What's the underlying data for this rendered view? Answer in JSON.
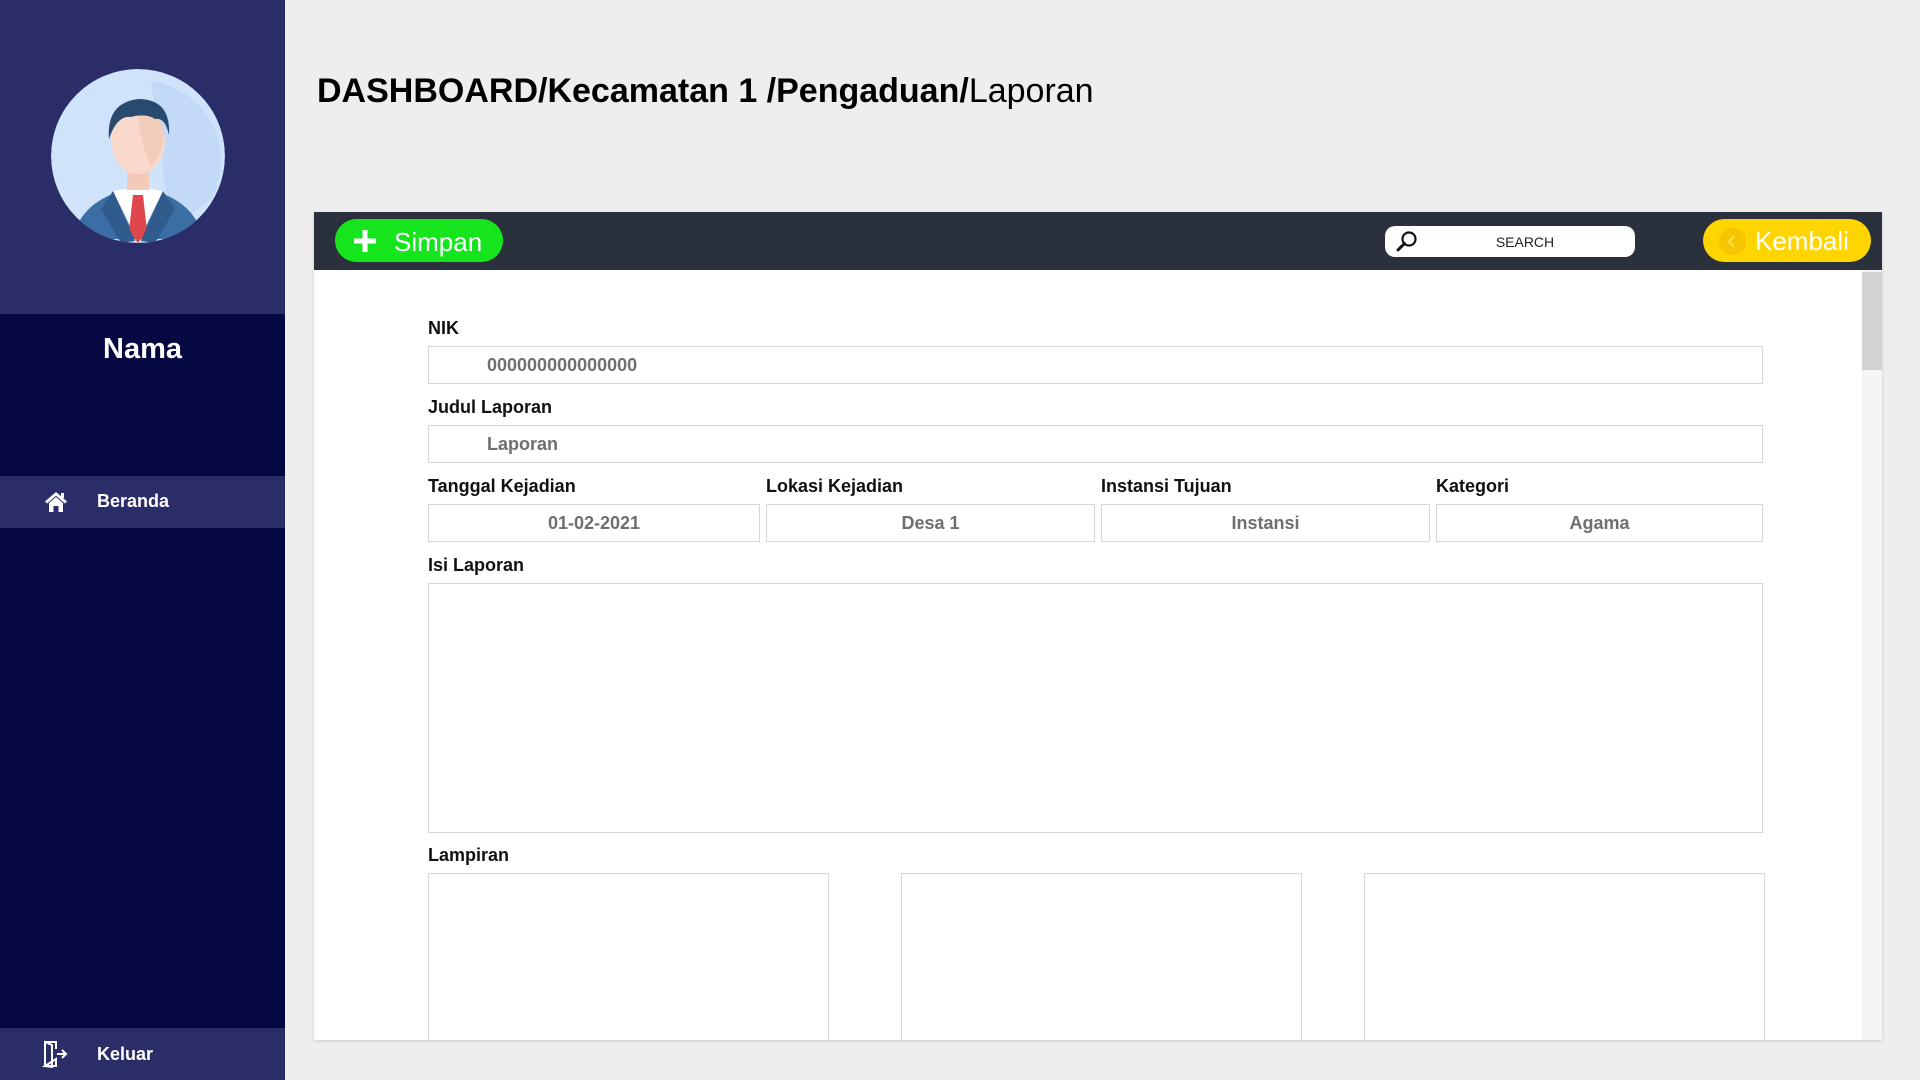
{
  "sidebar": {
    "user_name": "Nama",
    "nav": [
      {
        "label": "Beranda",
        "icon": "home-icon"
      }
    ],
    "logout_label": "Keluar"
  },
  "breadcrumb": {
    "bold_part": "DASHBOARD/Kecamatan 1 /Pengaduan/",
    "current": "Laporan"
  },
  "toolbar": {
    "save_label": "Simpan",
    "search_placeholder": "SEARCH",
    "back_label": "Kembali"
  },
  "form": {
    "nik": {
      "label": "NIK",
      "value": "000000000000000"
    },
    "judul": {
      "label": "Judul Laporan",
      "value": "Laporan"
    },
    "tanggal": {
      "label": "Tanggal Kejadian",
      "value": "01-02-2021"
    },
    "lokasi": {
      "label": "Lokasi Kejadian",
      "value": "Desa 1"
    },
    "instansi": {
      "label": "Instansi Tujuan",
      "value": "Instansi"
    },
    "kategori": {
      "label": "Kategori",
      "value": "Agama"
    },
    "isi": {
      "label": "Isi Laporan",
      "value": ""
    },
    "lampiran": {
      "label": "Lampiran"
    }
  },
  "colors": {
    "sidebar_dark": "#060941",
    "sidebar_light": "#2b2d68",
    "toolbar": "#2a313c",
    "save_green": "#16e51e",
    "back_yellow": "#ffd500"
  }
}
